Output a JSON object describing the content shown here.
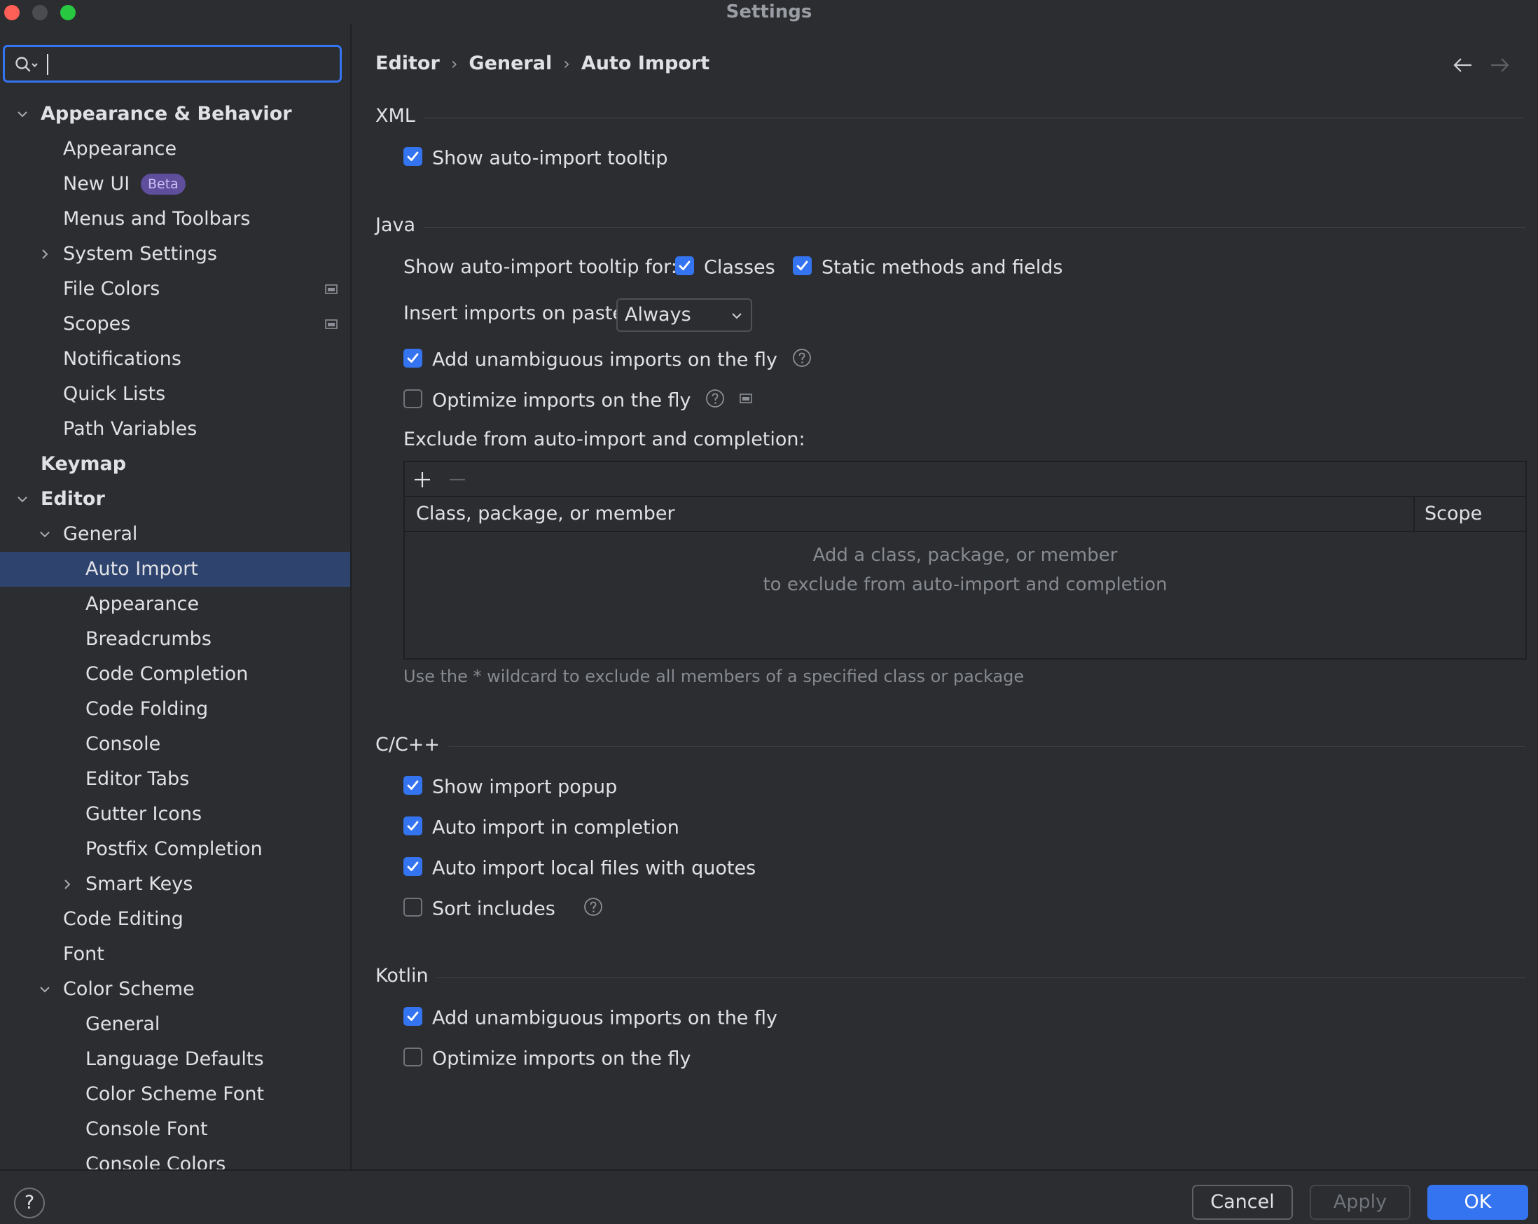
{
  "window": {
    "title": "Settings"
  },
  "search": {
    "value": "",
    "placeholder": ""
  },
  "sidebar": {
    "items": [
      {
        "label": "Appearance & Behavior",
        "level": 0,
        "bold": true,
        "chevron": "down"
      },
      {
        "label": "Appearance",
        "level": 1
      },
      {
        "label": "New UI",
        "level": 1,
        "badge": "Beta"
      },
      {
        "label": "Menus and Toolbars",
        "level": 1
      },
      {
        "label": "System Settings",
        "level": 1,
        "chevron": "right"
      },
      {
        "label": "File Colors",
        "level": 1,
        "project_icon": true
      },
      {
        "label": "Scopes",
        "level": 1,
        "project_icon": true
      },
      {
        "label": "Notifications",
        "level": 1
      },
      {
        "label": "Quick Lists",
        "level": 1
      },
      {
        "label": "Path Variables",
        "level": 1
      },
      {
        "label": "Keymap",
        "level": 0,
        "bold": true
      },
      {
        "label": "Editor",
        "level": 0,
        "bold": true,
        "chevron": "down"
      },
      {
        "label": "General",
        "level": 1,
        "chevron": "down"
      },
      {
        "label": "Auto Import",
        "level": 2,
        "selected": true
      },
      {
        "label": "Appearance",
        "level": 2
      },
      {
        "label": "Breadcrumbs",
        "level": 2
      },
      {
        "label": "Code Completion",
        "level": 2
      },
      {
        "label": "Code Folding",
        "level": 2
      },
      {
        "label": "Console",
        "level": 2
      },
      {
        "label": "Editor Tabs",
        "level": 2
      },
      {
        "label": "Gutter Icons",
        "level": 2
      },
      {
        "label": "Postfix Completion",
        "level": 2
      },
      {
        "label": "Smart Keys",
        "level": 2,
        "chevron": "right"
      },
      {
        "label": "Code Editing",
        "level": 1
      },
      {
        "label": "Font",
        "level": 1
      },
      {
        "label": "Color Scheme",
        "level": 1,
        "chevron": "down"
      },
      {
        "label": "General",
        "level": 2
      },
      {
        "label": "Language Defaults",
        "level": 2
      },
      {
        "label": "Color Scheme Font",
        "level": 2
      },
      {
        "label": "Console Font",
        "level": 2
      },
      {
        "label": "Console Colors",
        "level": 2
      }
    ]
  },
  "breadcrumb": [
    "Editor",
    "General",
    "Auto Import"
  ],
  "sections": {
    "xml": {
      "title": "XML",
      "show_tooltip": {
        "label": "Show auto-import tooltip",
        "checked": true
      }
    },
    "java": {
      "title": "Java",
      "tooltip_for_label": "Show auto-import tooltip for:",
      "classes": {
        "label": "Classes",
        "checked": true
      },
      "static_methods": {
        "label": "Static methods and fields",
        "checked": true
      },
      "insert_on_paste_label": "Insert imports on paste:",
      "insert_on_paste_value": "Always",
      "add_unambiguous": {
        "label": "Add unambiguous imports on the fly",
        "checked": true
      },
      "optimize_imports": {
        "label": "Optimize imports on the fly",
        "checked": false
      },
      "exclude_label": "Exclude from auto-import and completion:",
      "table": {
        "col_class": "Class, package, or member",
        "col_scope": "Scope",
        "empty_line1": "Add a class, package, or member",
        "empty_line2": "to exclude from auto-import and completion"
      },
      "hint": "Use the * wildcard to exclude all members of a specified class or package"
    },
    "cpp": {
      "title": "C/C++",
      "show_import_popup": {
        "label": "Show import popup",
        "checked": true
      },
      "auto_import_completion": {
        "label": "Auto import in completion",
        "checked": true
      },
      "auto_import_local": {
        "label": "Auto import local files with quotes",
        "checked": true
      },
      "sort_includes": {
        "label": "Sort includes",
        "checked": false
      }
    },
    "kotlin": {
      "title": "Kotlin",
      "add_unambiguous": {
        "label": "Add unambiguous imports on the fly",
        "checked": true
      },
      "optimize_imports": {
        "label": "Optimize imports on the fly",
        "checked": false
      }
    }
  },
  "footer": {
    "help": "?",
    "cancel": "Cancel",
    "apply": "Apply",
    "ok": "OK"
  },
  "colors": {
    "accent": "#3574f0",
    "selection": "#2e436e",
    "background": "#2b2d30",
    "badge": "#5e4e9c"
  },
  "icons": {
    "search": "search-icon",
    "back": "arrow-left-icon",
    "forward": "arrow-right-icon",
    "help": "question-circle-icon",
    "project": "project-scope-icon",
    "add": "plus-icon",
    "remove": "minus-icon"
  }
}
